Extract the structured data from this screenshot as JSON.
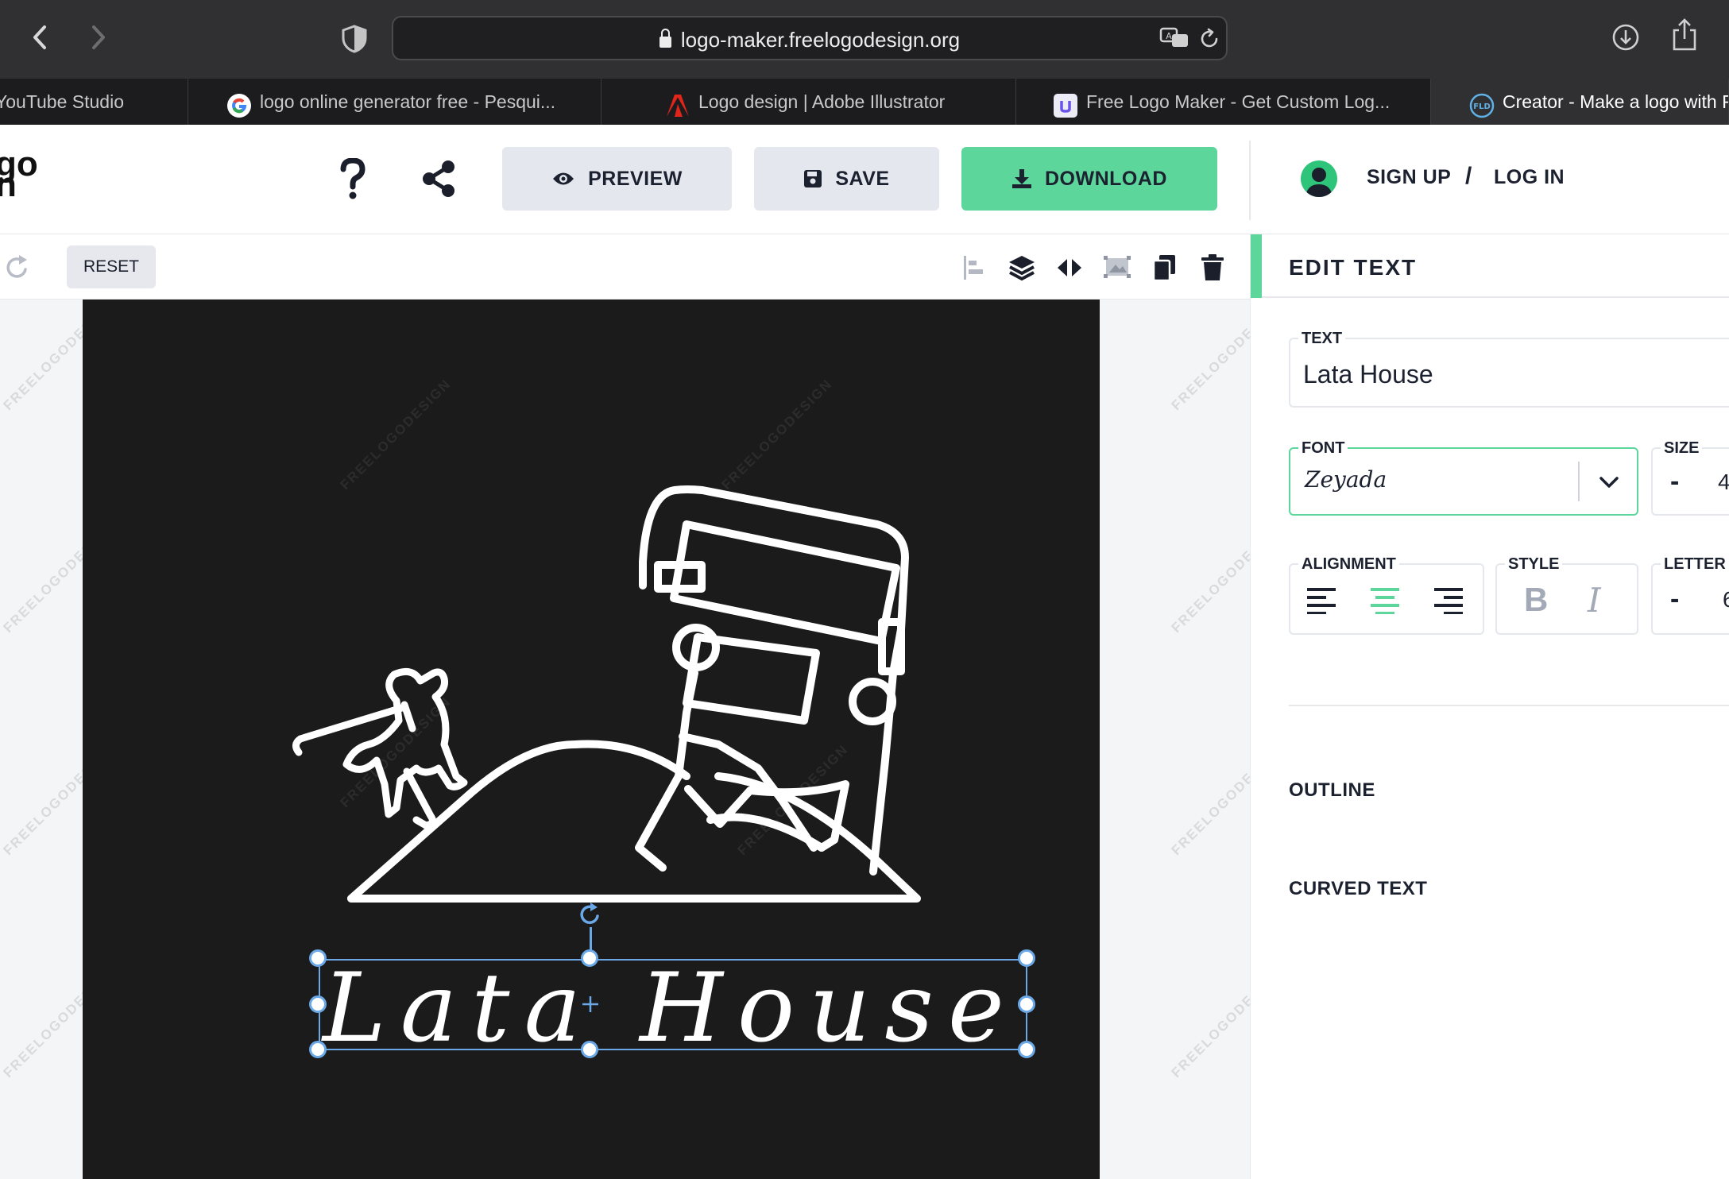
{
  "browser": {
    "url": "logo-maker.freelogodesign.org",
    "tabs": [
      {
        "label": "YouTube Studio"
      },
      {
        "label": "logo online generator free - Pesqui..."
      },
      {
        "label": "Logo design | Adobe Illustrator"
      },
      {
        "label": "Free Logo Maker - Get Custom Log..."
      },
      {
        "label": "Creator - Make a logo with F"
      }
    ]
  },
  "header": {
    "logo_fragment_1": "go",
    "logo_fragment_2": "n",
    "preview_label": "PREVIEW",
    "save_label": "SAVE",
    "download_label": "DOWNLOAD",
    "signup_label": "SIGN UP",
    "separator": "/",
    "login_label": "LOG IN"
  },
  "editbar": {
    "reset_label": "RESET"
  },
  "canvas": {
    "logo_text": "Lata House",
    "watermark": "FREELOGODESIGN",
    "background_color": "#1b1b1b"
  },
  "panel": {
    "title": "EDIT TEXT",
    "text_label": "TEXT",
    "text_value": "Lata House",
    "font_label": "FONT",
    "font_value": "Zeyada",
    "size_label": "SIZE",
    "size_minus": "-",
    "size_value": "4",
    "alignment_label": "ALIGNMENT",
    "style_label": "STYLE",
    "style_bold": "B",
    "style_italic": "I",
    "letter_label": "LETTER",
    "letter_minus": "-",
    "letter_value": "6",
    "outline_label": "OUTLINE",
    "curved_label": "CURVED TEXT",
    "selected_alignment": "center"
  },
  "colors": {
    "accent": "#5dd69b",
    "selection": "#6aa8e8",
    "text_dark": "#1c2130"
  }
}
